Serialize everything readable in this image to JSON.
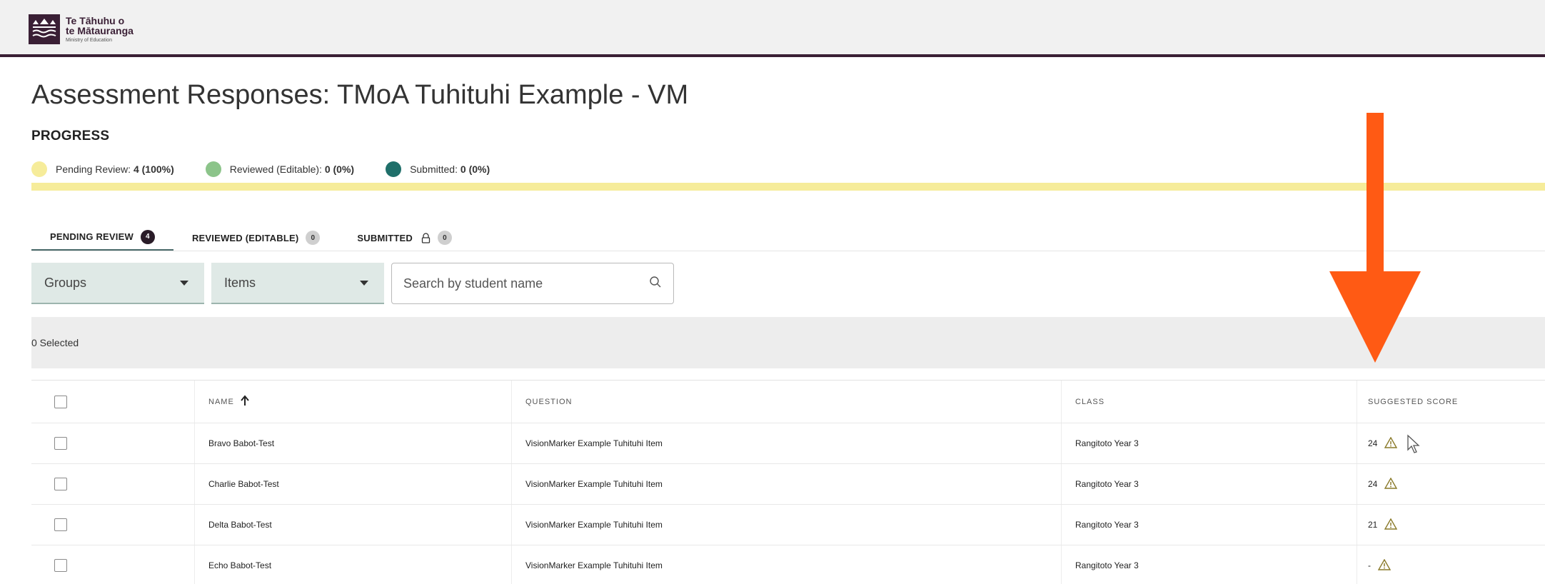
{
  "header": {
    "logo": {
      "line1": "Te Tāhuhu o",
      "line2": "te Mātauranga",
      "line3": "Ministry of Education"
    }
  },
  "page": {
    "title": "Assessment Responses: TMoA Tuhituhi Example - VM",
    "progress_label": "PROGRESS"
  },
  "progress": {
    "items": [
      {
        "label": "Pending Review:",
        "value": "4 (100%)",
        "color": "#f6ec9a"
      },
      {
        "label": "Reviewed (Editable):",
        "value": "0 (0%)",
        "color": "#8cc48a"
      },
      {
        "label": "Submitted:",
        "value": "0 (0%)",
        "color": "#1f6f6a"
      }
    ],
    "bar_color": "#f6ec9a",
    "pending_fraction": 1.0
  },
  "tabs": [
    {
      "label": "PENDING REVIEW",
      "count": "4",
      "active": true
    },
    {
      "label": "REVIEWED (EDITABLE)",
      "count": "0",
      "active": false
    },
    {
      "label": "SUBMITTED",
      "count": "0",
      "active": false,
      "icon": "lock-icon"
    }
  ],
  "filters": {
    "groups_label": "Groups",
    "items_label": "Items",
    "search_placeholder": "Search by student name"
  },
  "selection": {
    "text": "0 Selected"
  },
  "table": {
    "columns": [
      "NAME",
      "QUESTION",
      "CLASS",
      "SUGGESTED SCORE"
    ],
    "rows": [
      {
        "name": "Bravo Babot-Test",
        "question": "VisionMarker Example Tuhituhi Item",
        "class": "Rangitoto Year 3",
        "score": "24"
      },
      {
        "name": "Charlie Babot-Test",
        "question": "VisionMarker Example Tuhituhi Item",
        "class": "Rangitoto Year 3",
        "score": "24"
      },
      {
        "name": "Delta Babot-Test",
        "question": "VisionMarker Example Tuhituhi Item",
        "class": "Rangitoto Year 3",
        "score": "21"
      },
      {
        "name": "Echo Babot-Test",
        "question": "VisionMarker Example Tuhituhi Item",
        "class": "Rangitoto Year 3",
        "score": "-"
      }
    ]
  },
  "colors": {
    "brand": "#3a1f35",
    "arrow": "#ff5a14",
    "select_bg": "#dfe9e6"
  }
}
